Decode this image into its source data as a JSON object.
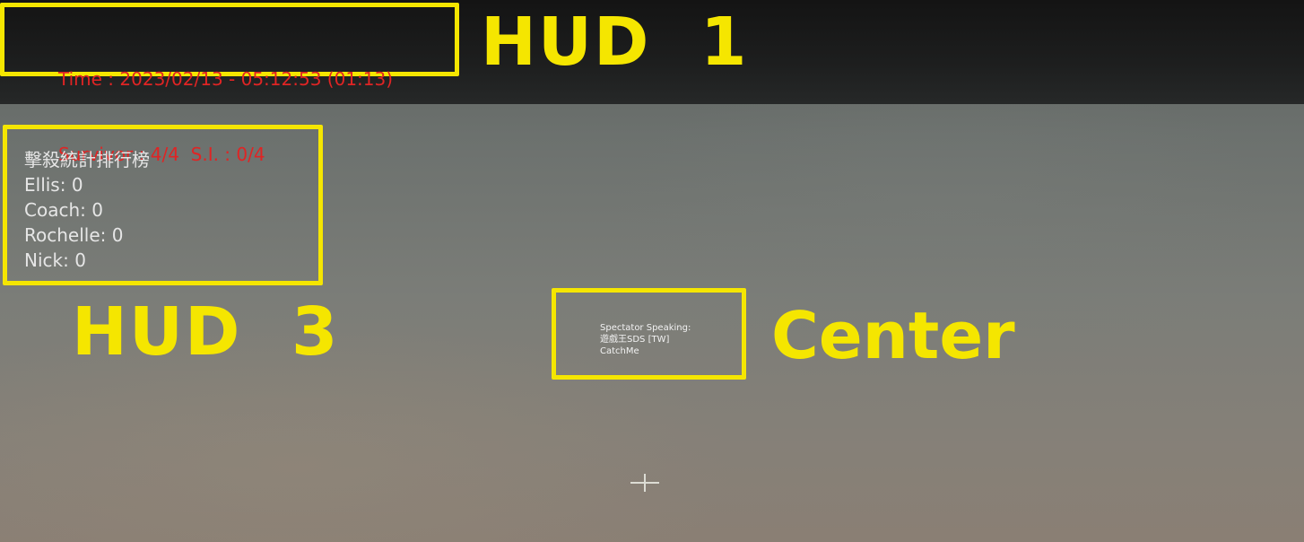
{
  "hud1": {
    "time_line": "Time : 2023/02/13 - 05:12:53 (01:13)",
    "status_line": "Survivor : 4/4  S.I. : 0/4",
    "annotation": "HUD  1",
    "text_color": "#e02424"
  },
  "hud3": {
    "title": "擊殺統計排行榜",
    "entries": [
      "Ellis: 0",
      "Coach: 0",
      "Rochelle: 0",
      "Nick: 0"
    ],
    "annotation": "HUD  3"
  },
  "center": {
    "line1": "Spectator Speaking:",
    "line2": "遊戲王SDS [TW]",
    "line3": "CatchMe",
    "annotation": "Center"
  },
  "colors": {
    "highlight": "#f5e600",
    "hud_text": "#e6e6e6"
  },
  "icons": {
    "crosshair": "crosshair-icon"
  }
}
